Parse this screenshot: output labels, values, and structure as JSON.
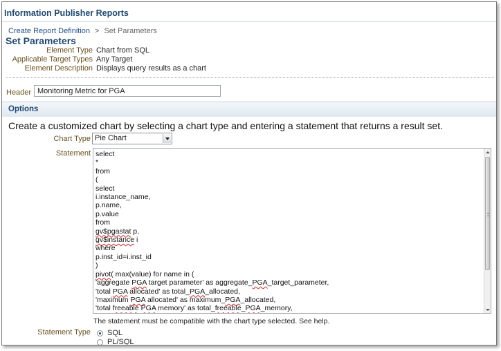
{
  "app": {
    "title": "Information Publisher Reports"
  },
  "breadcrumb": {
    "link": "Create Report Definition",
    "separator": ">",
    "current": "Set Parameters"
  },
  "page": {
    "title": "Set Parameters"
  },
  "info": [
    {
      "label": "Element Type",
      "value": "Chart from SQL"
    },
    {
      "label": "Applicable Target Types",
      "value": "Any Target"
    },
    {
      "label": "Element Description",
      "value": "Displays query results as a chart"
    }
  ],
  "header_field": {
    "label": "Header",
    "value": "Monitoring Metric for PGA"
  },
  "options": {
    "title": "Options",
    "instruction": "Create a customized chart by selecting a chart type and entering a statement that returns a result set."
  },
  "chart_type": {
    "label": "Chart Type",
    "selected": "Pie Chart"
  },
  "statement": {
    "label": "Statement",
    "lines": [
      "select",
      "*",
      "from",
      "(",
      "select",
      "i.instance_name,",
      "p.name,",
      "p.value",
      "from",
      "gv$pgastat p,",
      "gv$instance i",
      "where",
      "p.inst_id=i.inst_id",
      ")",
      "pivot( max(value) for name in (",
      "'aggregate PGA target parameter' as aggregate_PGA_target_parameter,",
      "'total PGA allocated' as total_PGA_allocated,",
      "'maximum PGA allocated' as maximum_PGA_allocated,",
      "'total freeable PGA memory' as total_freeable_PGA_memory,"
    ],
    "help": "The statement must be compatible with the chart type selected. See help."
  },
  "statement_type": {
    "label": "Statement Type",
    "options": [
      {
        "label": "SQL",
        "checked": true
      },
      {
        "label": "PL/SQL",
        "checked": false
      }
    ]
  }
}
